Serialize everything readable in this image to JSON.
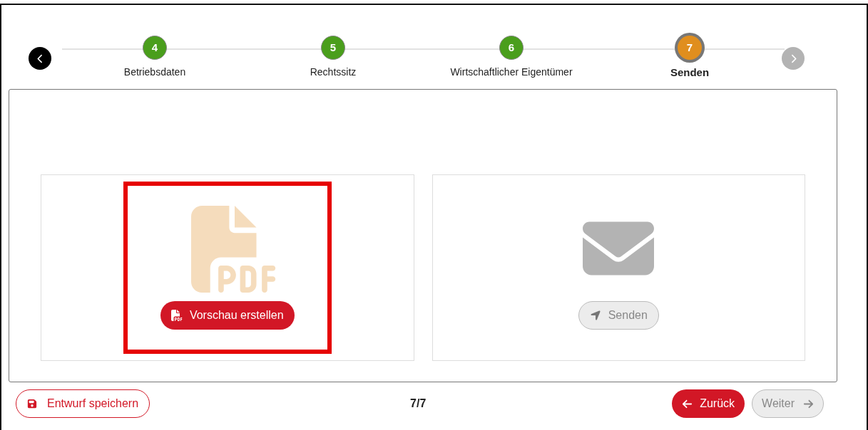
{
  "stepper": {
    "prev_enabled": true,
    "next_enabled": false,
    "steps": [
      {
        "number": "4",
        "label": "Betriebsdaten",
        "kind": "done",
        "selected": false
      },
      {
        "number": "5",
        "label": "Rechtssitz",
        "kind": "done",
        "selected": false
      },
      {
        "number": "6",
        "label": "Wirtschaftlicher Eigentümer",
        "kind": "done",
        "selected": false
      },
      {
        "number": "7",
        "label": "Senden",
        "kind": "current",
        "selected": true
      }
    ]
  },
  "cards": [
    {
      "kind": "pdf",
      "button": "Vorschau erstellen",
      "disabled": false,
      "highlighted": true
    },
    {
      "kind": "mail",
      "button": "Senden",
      "disabled": true,
      "highlighted": false
    }
  ],
  "footer": {
    "save_button": "Entwurf speichern",
    "page": "7/7",
    "back_button": "Zurück",
    "next_button": "Weiter",
    "next_disabled": true
  }
}
